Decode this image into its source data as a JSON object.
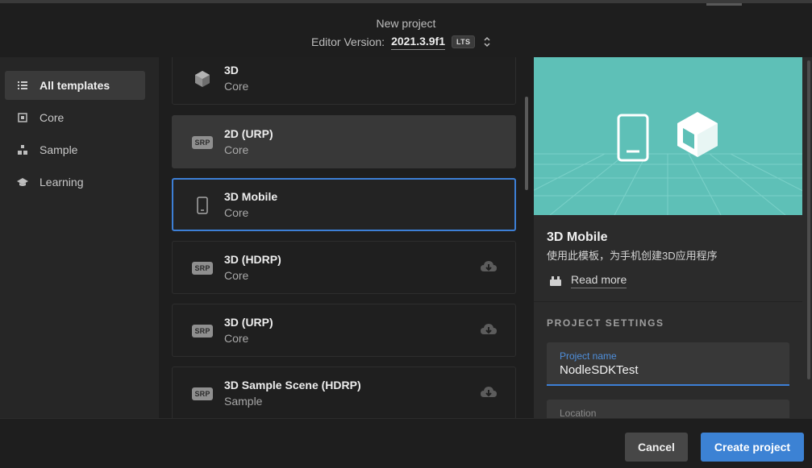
{
  "header": {
    "title": "New project",
    "editor_version_label": "Editor Version:",
    "editor_version": "2021.3.9f1",
    "lts_badge": "LTS"
  },
  "sidebar": {
    "items": [
      {
        "label": "All templates",
        "icon": "list-icon",
        "active": true
      },
      {
        "label": "Core",
        "icon": "core-square-icon",
        "active": false
      },
      {
        "label": "Sample",
        "icon": "sample-shapes-icon",
        "active": false
      },
      {
        "label": "Learning",
        "icon": "graduation-cap-icon",
        "active": false
      }
    ]
  },
  "templates": [
    {
      "title": "3D",
      "category": "Core",
      "icon": "cube-icon",
      "state": "normal",
      "download": false
    },
    {
      "title": "2D (URP)",
      "category": "Core",
      "icon": "srp-badge",
      "badge": "SRP",
      "state": "hover",
      "download": false
    },
    {
      "title": "3D Mobile",
      "category": "Core",
      "icon": "phone-icon",
      "state": "selected",
      "download": false
    },
    {
      "title": "3D (HDRP)",
      "category": "Core",
      "icon": "srp-badge",
      "badge": "SRP",
      "state": "normal",
      "download": true
    },
    {
      "title": "3D (URP)",
      "category": "Core",
      "icon": "srp-badge",
      "badge": "SRP",
      "state": "normal",
      "download": true
    },
    {
      "title": "3D Sample Scene (HDRP)",
      "category": "Sample",
      "icon": "srp-badge",
      "badge": "SRP",
      "state": "normal",
      "download": true
    }
  ],
  "details": {
    "preview_bg_color": "#5ec0b7",
    "title": "3D Mobile",
    "description": "使用此模板，为手机创建3D应用程序",
    "read_more": "Read more",
    "settings_header": "PROJECT SETTINGS",
    "project_name_label": "Project name",
    "project_name_value": "NodleSDKTest",
    "location_label": "Location"
  },
  "footer": {
    "cancel_label": "Cancel",
    "create_label": "Create project",
    "accent_color": "#3c82d4"
  }
}
